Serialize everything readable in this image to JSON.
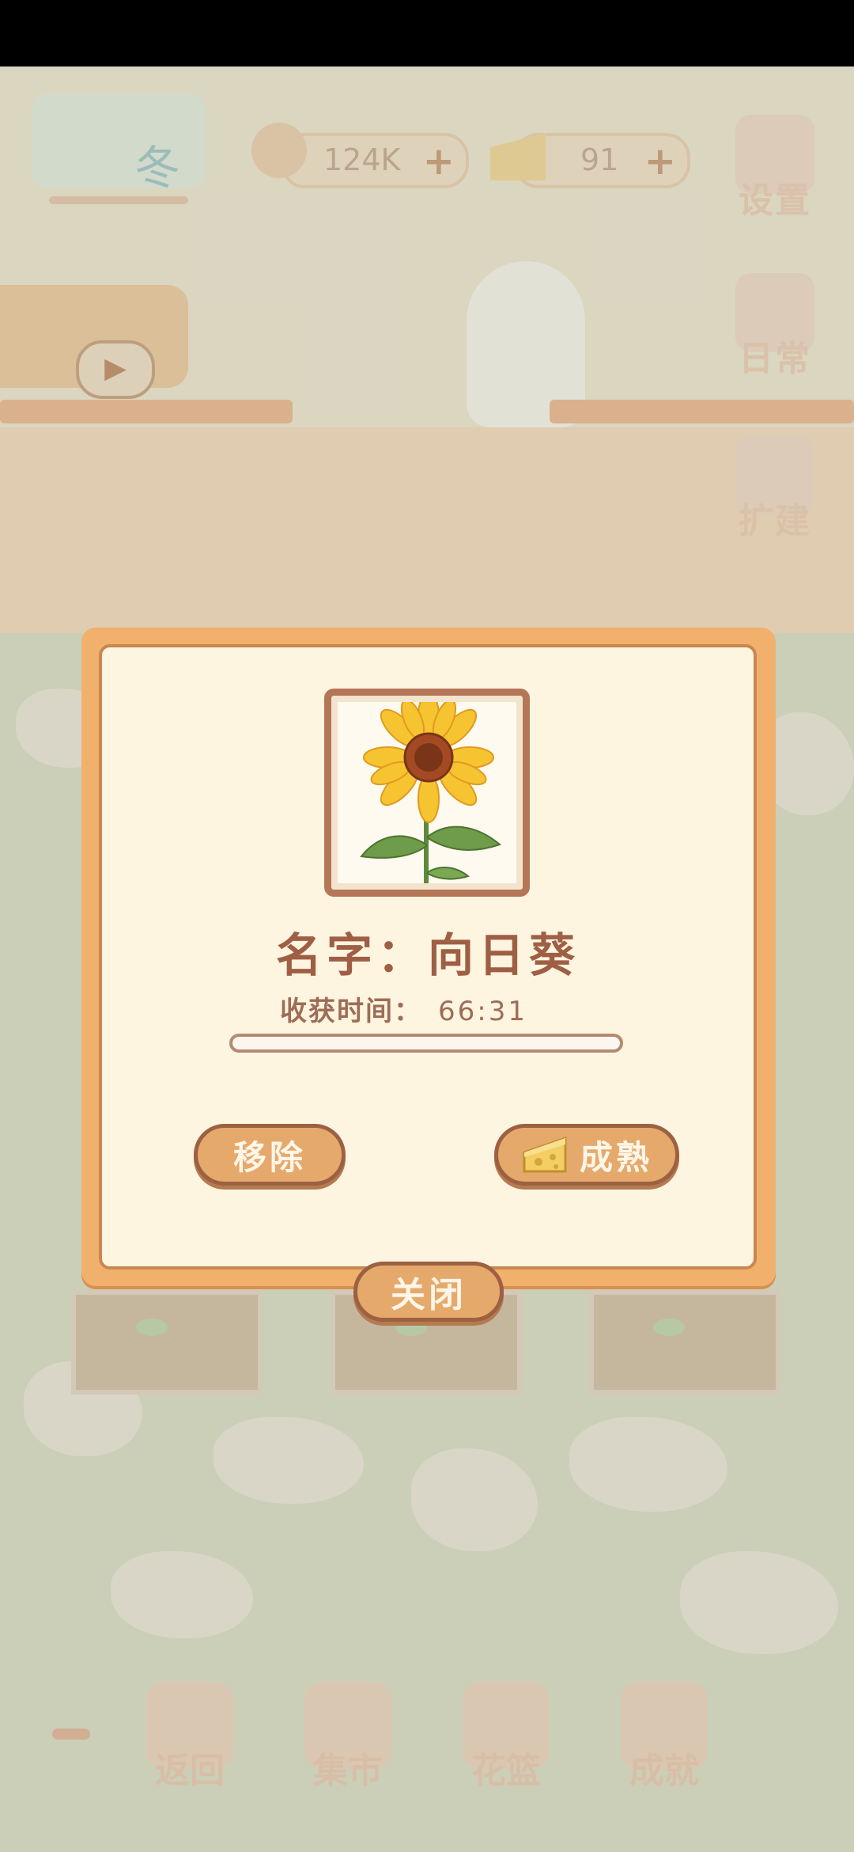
{
  "hud": {
    "season": "冬",
    "fish_currency": "124K",
    "cheese_currency": "91",
    "plus_symbol": "+"
  },
  "side_menu": {
    "settings": "设置",
    "daily": "日常",
    "expand": "扩建"
  },
  "dialog": {
    "name_line": "名字：向日葵",
    "harvest_label": "收获时间：",
    "harvest_time": "66:31",
    "progress": 0,
    "remove_label": "移除",
    "ripen_label": "成熟",
    "close_label": "关闭"
  },
  "bottom_bar": {
    "back": "返回",
    "market": "集市",
    "basket": "花篮",
    "achievements": "成就"
  }
}
